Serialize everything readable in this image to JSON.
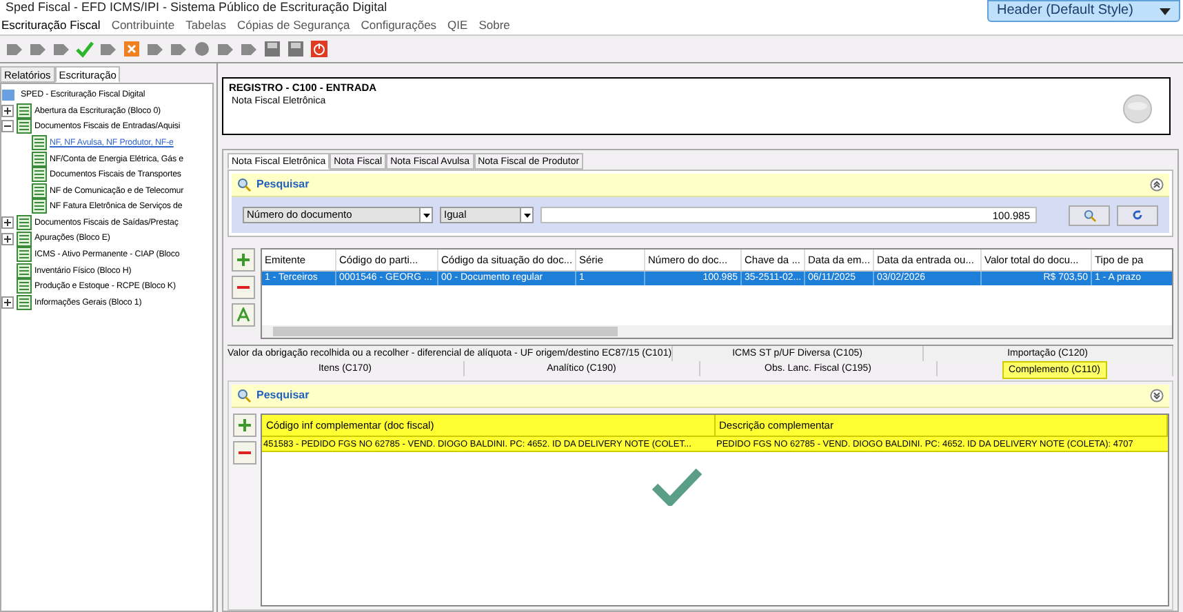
{
  "window": {
    "title": "Sped Fiscal - EFD ICMS/IPI - Sistema Público de Escrituração Digital"
  },
  "style_dropdown": {
    "value": "Header (Default Style)"
  },
  "menu": [
    "Escrituração Fiscal",
    "Contribuinte",
    "Tabelas",
    "Cópias de Segurança",
    "Configurações",
    "QIE",
    "Sobre"
  ],
  "sidebar": {
    "tabs": [
      {
        "label": "Relatórios",
        "selected": false
      },
      {
        "label": "Escrituração",
        "selected": true
      }
    ],
    "tree": {
      "label": "SPED - Escrituração Fiscal Digital",
      "children": [
        {
          "label": "Abertura da Escrituração (Bloco 0)",
          "expanded": false,
          "selected": false
        },
        {
          "label": "Documentos Fiscais de Entradas/Aquisi",
          "expanded": true,
          "selected": false,
          "children": [
            {
              "label": "NF, NF Avulsa, NF Produtor, NF-e",
              "selected": true
            },
            {
              "label": "NF/Conta de Energia Elétrica, Gás e",
              "selected": false
            },
            {
              "label": "Documentos Fiscais de Transportes",
              "selected": false
            },
            {
              "label": "NF de Comunicação e de Telecomur",
              "selected": false
            },
            {
              "label": "NF Fatura Eletrônica de Serviços de",
              "selected": false
            }
          ]
        },
        {
          "label": "Documentos Fiscais de Saídas/Prestaç",
          "expanded": false,
          "selected": false
        },
        {
          "label": "Apurações (Bloco E)",
          "expanded": false,
          "selected": false
        },
        {
          "label": "ICMS - Ativo Permanente - CIAP (Bloco",
          "selected": false
        },
        {
          "label": "Inventário Físico (Bloco H)",
          "selected": false
        },
        {
          "label": "Produção e Estoque - RCPE (Bloco K)",
          "selected": false
        },
        {
          "label": "Informações Gerais (Bloco 1)",
          "expanded": false,
          "selected": false
        }
      ]
    }
  },
  "record": {
    "title": "REGISTRO - C100 - ENTRADA",
    "subtitle": "Nota Fiscal Eletrônica"
  },
  "tabs": [
    {
      "label": "Nota Fiscal Eletrônica",
      "selected": true
    },
    {
      "label": "Nota Fiscal",
      "selected": false
    },
    {
      "label": "Nota Fiscal Avulsa",
      "selected": false
    },
    {
      "label": "Nota Fiscal de Produtor",
      "selected": false
    }
  ],
  "search": {
    "title": "Pesquisar",
    "expanded": true,
    "field": "Número do documento",
    "operator": "Igual",
    "value": "100.985"
  },
  "table": {
    "columns": [
      "Emitente",
      "Código do parti...",
      "Código da situação do doc...",
      "Série",
      "Número do doc...",
      "Chave da ...",
      "Data da em...",
      "Data da entrada ou...",
      "Valor total do docu...",
      "Tipo de pa"
    ],
    "rows": [
      {
        "selected": true,
        "cells": [
          "1 - Terceiros",
          "0001546 - GEORG ...",
          "00 - Documento regular",
          "1",
          "100.985",
          "35-2511-02...",
          "06/11/2025",
          "03/02/2026",
          "R$ 703,50",
          "1 - A prazo"
        ]
      }
    ]
  },
  "sub_tabs": {
    "row_1": [
      {
        "label": "Valor da obrigação recolhida ou a recolher - diferencial de alíquota - UF origem/destino EC87/15 (C101)",
        "selected": false
      },
      {
        "label": "ICMS ST p/UF Diversa (C105)",
        "selected": false
      },
      {
        "label": "Importação (C120)",
        "selected": false
      }
    ],
    "row_2": [
      {
        "label": "Itens (C170)",
        "selected": false
      },
      {
        "label": "Analítico (C190)",
        "selected": false
      },
      {
        "label": "Obs. Lanc. Fiscal (C195)",
        "selected": false
      },
      {
        "label": "Complemento (C110)",
        "selected": true
      }
    ]
  },
  "sub_search": {
    "title": "Pesquisar",
    "expanded": false
  },
  "sub_table": {
    "columns": [
      "Código inf complementar (doc fiscal)",
      "Descrição complementar"
    ],
    "rows": [
      {
        "selected": true,
        "cells": [
          "451583 - PEDIDO FGS NO 62785 - VEND. DIOGO BALDINI. PC: 4652. ID DA DELIVERY NOTE (COLET...",
          "PEDIDO FGS NO 62785 - VEND. DIOGO BALDINI. PC: 4652. ID DA DELIVERY NOTE (COLETA): 4707"
        ]
      }
    ]
  }
}
